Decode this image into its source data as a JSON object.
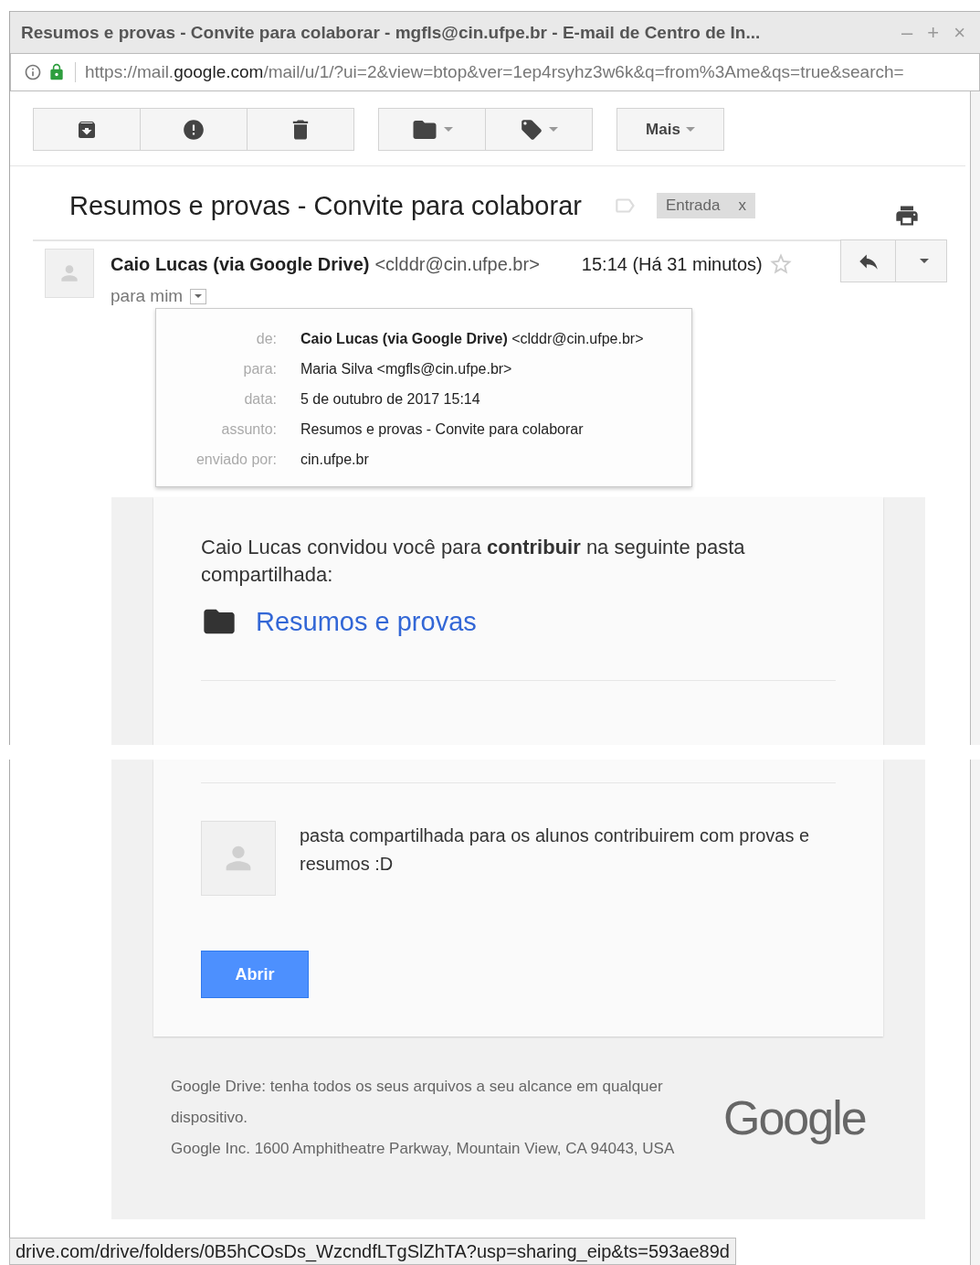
{
  "window": {
    "title": "Resumos e provas - Convite para colaborar - mgfls@cin.ufpe.br - E-mail de Centro de In...",
    "controls": [
      "–",
      "+",
      "×"
    ]
  },
  "address_bar": {
    "url_start": "https://mail.",
    "url_domain": "google.com",
    "url_rest": "/mail/u/1/?ui=2&view=btop&ver=1ep4rsyhz3w6k&q=from%3Ame&qs=true&search="
  },
  "toolbar": {
    "more_button": "Mais"
  },
  "message": {
    "subject": "Resumos e provas - Convite para colaborar",
    "label": "Entrada",
    "label_remove": "x",
    "sender_name": "Caio Lucas (via Google Drive)",
    "sender_email": "<clddr@cin.ufpe.br>",
    "recipient": "para mim",
    "time": "15:14 (Há 31 minutos)"
  },
  "details_popup": {
    "rows": [
      {
        "label": "de:",
        "value": "**Caio Lucas (via Google Drive)** <clddr@cin.ufpe.br>"
      },
      {
        "label": "para:",
        "value": "Maria Silva <mgfls@cin.ufpe.br>"
      },
      {
        "label": "data:",
        "value": "5 de outubro de 2017 15:14"
      },
      {
        "label": "assunto:",
        "value": "Resumos e provas - Convite para colaborar"
      },
      {
        "label": "enviado por:",
        "value": "cin.ufpe.br"
      }
    ]
  },
  "invite": {
    "text": "Caio Lucas convidou você para **contribuir** na seguinte pasta compartilhada:",
    "folder_link": "Resumos e provas",
    "comment": "pasta compartilhada para os alunos contribuirem com provas e resumos :D",
    "open_button": "Abrir"
  },
  "footer": {
    "lines": [
      "Google Drive: tenha todos os seus arquivos a seu alcance em qualquer dispositivo.",
      "Google Inc. 1600 Amphitheatre Parkway, Mountain View, CA 94043, USA"
    ],
    "logo": "Google"
  },
  "status_bar": {
    "url": "drive.com/drive/folders/0B5hCOsDs_WzcndfLTgSlZhTA?usp=sharing_eip&ts=593ae89d"
  }
}
